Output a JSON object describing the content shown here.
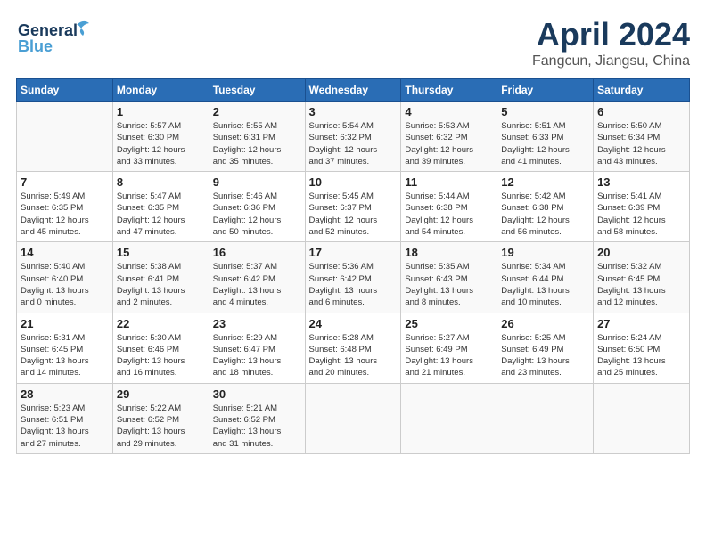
{
  "header": {
    "logo_general": "General",
    "logo_blue": "Blue",
    "title": "April 2024",
    "subtitle": "Fangcun, Jiangsu, China"
  },
  "days_of_week": [
    "Sunday",
    "Monday",
    "Tuesday",
    "Wednesday",
    "Thursday",
    "Friday",
    "Saturday"
  ],
  "weeks": [
    [
      {
        "day": "",
        "info": ""
      },
      {
        "day": "1",
        "info": "Sunrise: 5:57 AM\nSunset: 6:30 PM\nDaylight: 12 hours\nand 33 minutes."
      },
      {
        "day": "2",
        "info": "Sunrise: 5:55 AM\nSunset: 6:31 PM\nDaylight: 12 hours\nand 35 minutes."
      },
      {
        "day": "3",
        "info": "Sunrise: 5:54 AM\nSunset: 6:32 PM\nDaylight: 12 hours\nand 37 minutes."
      },
      {
        "day": "4",
        "info": "Sunrise: 5:53 AM\nSunset: 6:32 PM\nDaylight: 12 hours\nand 39 minutes."
      },
      {
        "day": "5",
        "info": "Sunrise: 5:51 AM\nSunset: 6:33 PM\nDaylight: 12 hours\nand 41 minutes."
      },
      {
        "day": "6",
        "info": "Sunrise: 5:50 AM\nSunset: 6:34 PM\nDaylight: 12 hours\nand 43 minutes."
      }
    ],
    [
      {
        "day": "7",
        "info": "Sunrise: 5:49 AM\nSunset: 6:35 PM\nDaylight: 12 hours\nand 45 minutes."
      },
      {
        "day": "8",
        "info": "Sunrise: 5:47 AM\nSunset: 6:35 PM\nDaylight: 12 hours\nand 47 minutes."
      },
      {
        "day": "9",
        "info": "Sunrise: 5:46 AM\nSunset: 6:36 PM\nDaylight: 12 hours\nand 50 minutes."
      },
      {
        "day": "10",
        "info": "Sunrise: 5:45 AM\nSunset: 6:37 PM\nDaylight: 12 hours\nand 52 minutes."
      },
      {
        "day": "11",
        "info": "Sunrise: 5:44 AM\nSunset: 6:38 PM\nDaylight: 12 hours\nand 54 minutes."
      },
      {
        "day": "12",
        "info": "Sunrise: 5:42 AM\nSunset: 6:38 PM\nDaylight: 12 hours\nand 56 minutes."
      },
      {
        "day": "13",
        "info": "Sunrise: 5:41 AM\nSunset: 6:39 PM\nDaylight: 12 hours\nand 58 minutes."
      }
    ],
    [
      {
        "day": "14",
        "info": "Sunrise: 5:40 AM\nSunset: 6:40 PM\nDaylight: 13 hours\nand 0 minutes."
      },
      {
        "day": "15",
        "info": "Sunrise: 5:38 AM\nSunset: 6:41 PM\nDaylight: 13 hours\nand 2 minutes."
      },
      {
        "day": "16",
        "info": "Sunrise: 5:37 AM\nSunset: 6:42 PM\nDaylight: 13 hours\nand 4 minutes."
      },
      {
        "day": "17",
        "info": "Sunrise: 5:36 AM\nSunset: 6:42 PM\nDaylight: 13 hours\nand 6 minutes."
      },
      {
        "day": "18",
        "info": "Sunrise: 5:35 AM\nSunset: 6:43 PM\nDaylight: 13 hours\nand 8 minutes."
      },
      {
        "day": "19",
        "info": "Sunrise: 5:34 AM\nSunset: 6:44 PM\nDaylight: 13 hours\nand 10 minutes."
      },
      {
        "day": "20",
        "info": "Sunrise: 5:32 AM\nSunset: 6:45 PM\nDaylight: 13 hours\nand 12 minutes."
      }
    ],
    [
      {
        "day": "21",
        "info": "Sunrise: 5:31 AM\nSunset: 6:45 PM\nDaylight: 13 hours\nand 14 minutes."
      },
      {
        "day": "22",
        "info": "Sunrise: 5:30 AM\nSunset: 6:46 PM\nDaylight: 13 hours\nand 16 minutes."
      },
      {
        "day": "23",
        "info": "Sunrise: 5:29 AM\nSunset: 6:47 PM\nDaylight: 13 hours\nand 18 minutes."
      },
      {
        "day": "24",
        "info": "Sunrise: 5:28 AM\nSunset: 6:48 PM\nDaylight: 13 hours\nand 20 minutes."
      },
      {
        "day": "25",
        "info": "Sunrise: 5:27 AM\nSunset: 6:49 PM\nDaylight: 13 hours\nand 21 minutes."
      },
      {
        "day": "26",
        "info": "Sunrise: 5:25 AM\nSunset: 6:49 PM\nDaylight: 13 hours\nand 23 minutes."
      },
      {
        "day": "27",
        "info": "Sunrise: 5:24 AM\nSunset: 6:50 PM\nDaylight: 13 hours\nand 25 minutes."
      }
    ],
    [
      {
        "day": "28",
        "info": "Sunrise: 5:23 AM\nSunset: 6:51 PM\nDaylight: 13 hours\nand 27 minutes."
      },
      {
        "day": "29",
        "info": "Sunrise: 5:22 AM\nSunset: 6:52 PM\nDaylight: 13 hours\nand 29 minutes."
      },
      {
        "day": "30",
        "info": "Sunrise: 5:21 AM\nSunset: 6:52 PM\nDaylight: 13 hours\nand 31 minutes."
      },
      {
        "day": "",
        "info": ""
      },
      {
        "day": "",
        "info": ""
      },
      {
        "day": "",
        "info": ""
      },
      {
        "day": "",
        "info": ""
      }
    ]
  ]
}
